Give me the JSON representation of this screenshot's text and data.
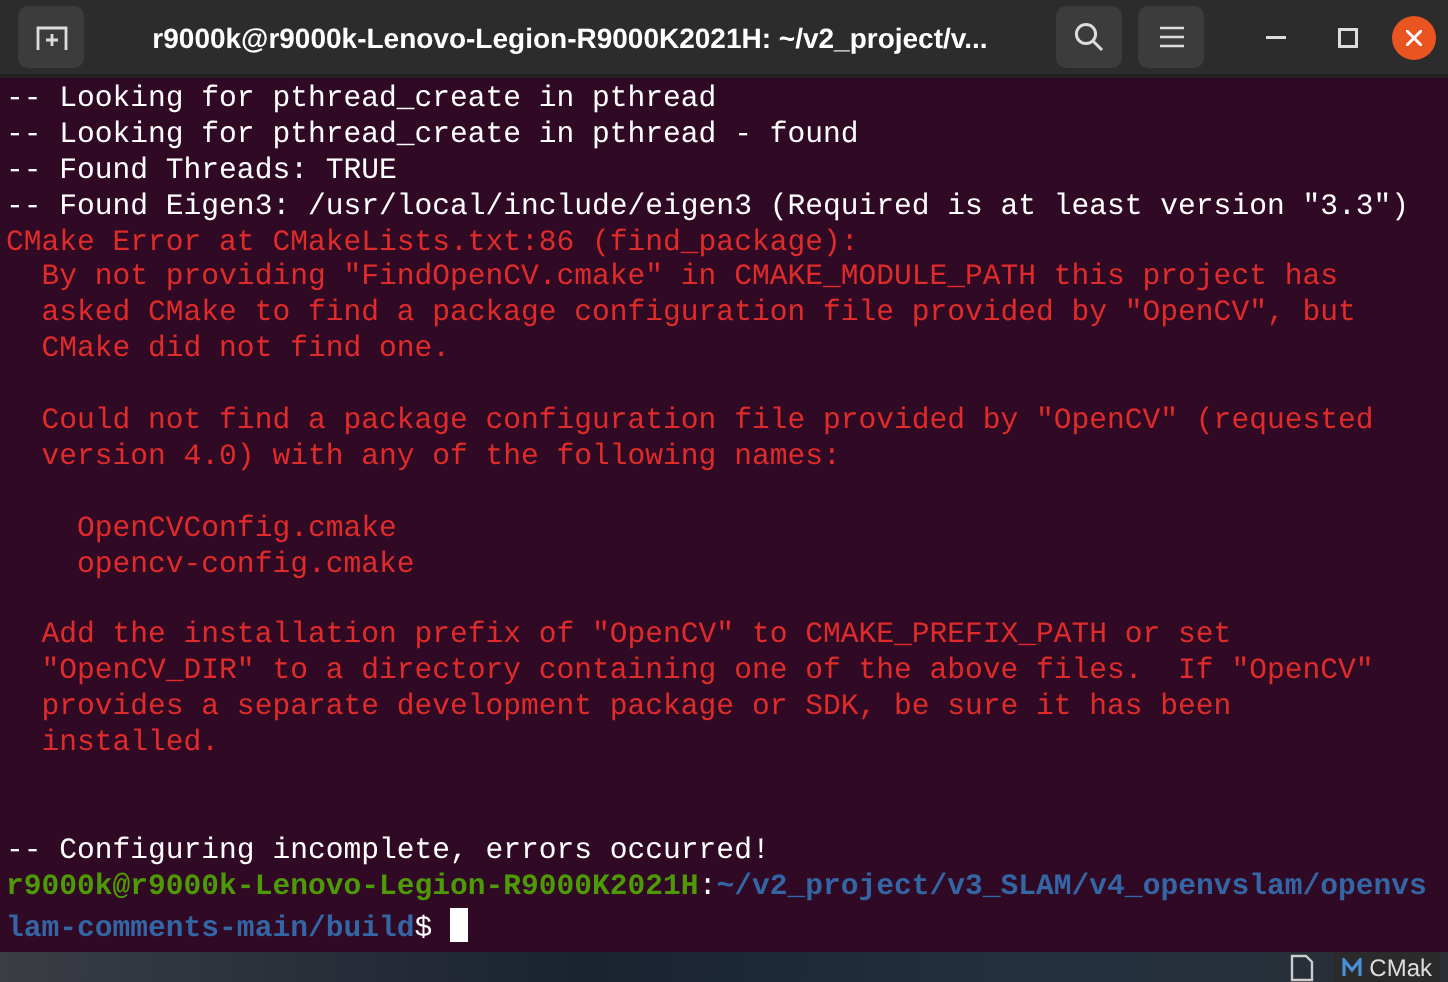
{
  "window": {
    "title": "r9000k@r9000k-Lenovo-Legion-R9000K2021H: ~/v2_project/v..."
  },
  "terminal": {
    "lines": [
      {
        "kind": "normal",
        "text": "-- Looking for pthread_create in pthread"
      },
      {
        "kind": "normal",
        "text": "-- Looking for pthread_create in pthread - found"
      },
      {
        "kind": "normal",
        "text": "-- Found Threads: TRUE"
      },
      {
        "kind": "normal",
        "text": "-- Found Eigen3: /usr/local/include/eigen3 (Required is at least version \"3.3\")"
      },
      {
        "kind": "error",
        "text": "CMake Error at CMakeLists.txt:86 (find_package):"
      },
      {
        "kind": "error",
        "text": "  By not providing \"FindOpenCV.cmake\" in CMAKE_MODULE_PATH this project has"
      },
      {
        "kind": "error",
        "text": "  asked CMake to find a package configuration file provided by \"OpenCV\", but"
      },
      {
        "kind": "error",
        "text": "  CMake did not find one."
      },
      {
        "kind": "blank"
      },
      {
        "kind": "error",
        "text": "  Could not find a package configuration file provided by \"OpenCV\" (requested"
      },
      {
        "kind": "error",
        "text": "  version 4.0) with any of the following names:"
      },
      {
        "kind": "blank"
      },
      {
        "kind": "error",
        "text": "    OpenCVConfig.cmake"
      },
      {
        "kind": "error",
        "text": "    opencv-config.cmake"
      },
      {
        "kind": "blank"
      },
      {
        "kind": "error",
        "text": "  Add the installation prefix of \"OpenCV\" to CMAKE_PREFIX_PATH or set"
      },
      {
        "kind": "error",
        "text": "  \"OpenCV_DIR\" to a directory containing one of the above files.  If \"OpenCV\""
      },
      {
        "kind": "error",
        "text": "  provides a separate development package or SDK, be sure it has been"
      },
      {
        "kind": "error",
        "text": "  installed."
      },
      {
        "kind": "blank"
      },
      {
        "kind": "blank"
      },
      {
        "kind": "normal",
        "text": "-- Configuring incomplete, errors occurred!"
      }
    ],
    "prompt": {
      "user_host": "r9000k@r9000k-Lenovo-Legion-R9000K2021H",
      "separator": ":",
      "path": "~/v2_project/v3_SLAM/v4_openvslam/openvslam-comments-main/build",
      "symbol": "$"
    }
  },
  "taskbar": {
    "app_label": "CMak"
  }
}
